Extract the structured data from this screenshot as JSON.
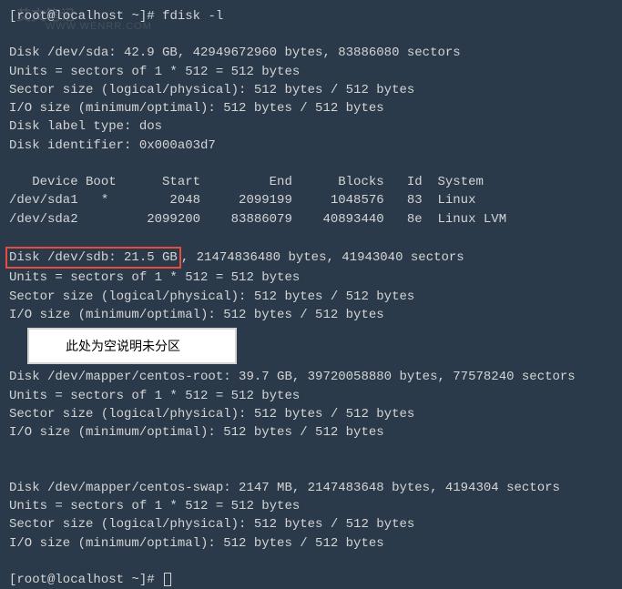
{
  "watermark_cn": "艾文笔记",
  "watermark": "WWW.WENRR.COM",
  "prompt": {
    "user": "root",
    "at": "@",
    "host": "localhost",
    "dir": "~",
    "symbol": "#",
    "command": "fdisk -l"
  },
  "sda": {
    "header": "Disk /dev/sda: 42.9 GB, 42949672960 bytes, 83886080 sectors",
    "units": "Units = sectors of 1 * 512 = 512 bytes",
    "sector": "Sector size (logical/physical): 512 bytes / 512 bytes",
    "iosize": "I/O size (minimum/optimal): 512 bytes / 512 bytes",
    "label": "Disk label type: dos",
    "identifier": "Disk identifier: 0x000a03d7"
  },
  "table": {
    "header": "   Device Boot      Start         End      Blocks   Id  System",
    "row1": "/dev/sda1   *        2048     2099199     1048576   83  Linux",
    "row2": "/dev/sda2         2099200    83886079    40893440   8e  Linux LVM"
  },
  "sdb": {
    "highlighted": "Disk /dev/sdb: 21.5 GB",
    "rest": ", 21474836480 bytes, 41943040 sectors",
    "units": "Units = sectors of 1 * 512 = 512 bytes",
    "sector": "Sector size (logical/physical): 512 bytes / 512 bytes",
    "iosize": "I/O size (minimum/optimal): 512 bytes / 512 bytes"
  },
  "annotation": "此处为空说明未分区",
  "root_dm": {
    "header": "Disk /dev/mapper/centos-root: 39.7 GB, 39720058880 bytes, 77578240 sectors",
    "units": "Units = sectors of 1 * 512 = 512 bytes",
    "sector": "Sector size (logical/physical): 512 bytes / 512 bytes",
    "iosize": "I/O size (minimum/optimal): 512 bytes / 512 bytes"
  },
  "swap_dm": {
    "header": "Disk /dev/mapper/centos-swap: 2147 MB, 2147483648 bytes, 4194304 sectors",
    "units": "Units = sectors of 1 * 512 = 512 bytes",
    "sector": "Sector size (logical/physical): 512 bytes / 512 bytes",
    "iosize": "I/O size (minimum/optimal): 512 bytes / 512 bytes"
  },
  "prompt_end": "[root@localhost ~]# "
}
